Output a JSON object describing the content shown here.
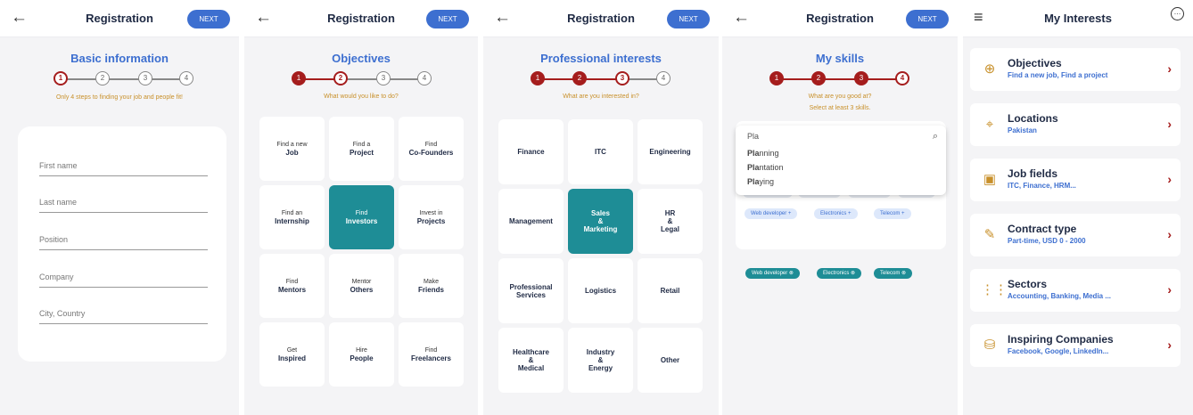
{
  "screen1": {
    "title": "Registration",
    "next": "NEXT",
    "heading": "Basic information",
    "steps": [
      "1",
      "2",
      "3",
      "4"
    ],
    "hint": "Only 4 steps to finding your job and people fit!",
    "fields": [
      "First name",
      "Last name",
      "Position",
      "Company",
      "City, Country"
    ]
  },
  "screen2": {
    "title": "Registration",
    "next": "NEXT",
    "heading": "Objectives",
    "steps": [
      "1",
      "2",
      "3",
      "4"
    ],
    "hint": "What would you like to do?",
    "tiles": [
      [
        "Find a new",
        "Job"
      ],
      [
        "Find a",
        "Project"
      ],
      [
        "Find",
        "Co-Founders"
      ],
      [
        "Find an",
        "Internship"
      ],
      [
        "Find",
        "Investors"
      ],
      [
        "Invest in",
        "Projects"
      ],
      [
        "Find",
        "Mentors"
      ],
      [
        "Mentor",
        "Others"
      ],
      [
        "Make",
        "Friends"
      ],
      [
        "Get",
        "Inspired"
      ],
      [
        "Hire",
        "People"
      ],
      [
        "Find",
        "Freelancers"
      ]
    ]
  },
  "screen3": {
    "title": "Registration",
    "next": "NEXT",
    "heading": "Professional interests",
    "steps": [
      "1",
      "2",
      "3",
      "4"
    ],
    "hint": "What are you interested in?",
    "tiles": [
      [
        "Finance"
      ],
      [
        "ITC"
      ],
      [
        "Engineering"
      ],
      [
        "Management"
      ],
      [
        "Sales",
        "&",
        "Marketing"
      ],
      [
        "HR",
        "&",
        "Legal"
      ],
      [
        "Professional",
        "Services"
      ],
      [
        "Logistics"
      ],
      [
        "Retail"
      ],
      [
        "Healthcare",
        "&",
        "Medical"
      ],
      [
        "Industry",
        "&",
        "Energy"
      ],
      [
        "Other"
      ]
    ]
  },
  "screen4": {
    "title": "Registration",
    "next": "NEXT",
    "heading": "My skills",
    "steps": [
      "1",
      "2",
      "3",
      "4"
    ],
    "hint1": "What are you good at?",
    "hint2": "Select at least 3 skills.",
    "search": "Pla",
    "suggestions": [
      [
        "Pla",
        "nning"
      ],
      [
        "Pla",
        "ntation"
      ],
      [
        "Pla",
        "ying"
      ]
    ],
    "chips": [
      "Web developer +",
      "Electronics +",
      "Telecom +"
    ],
    "selected": [
      "Web developer ⊗",
      "Electronics ⊗",
      "Telecom ⊗"
    ]
  },
  "screen5": {
    "title": "My Interests",
    "chat_icon": "…",
    "cards": [
      {
        "title": "Objectives",
        "sub": "Find a new job,  Find a project",
        "icon": "crosshair-icon"
      },
      {
        "title": "Locations",
        "sub": "Pakistan",
        "icon": "map-pin-icon"
      },
      {
        "title": "Job fields",
        "sub": "ITC, Finance, HRM...",
        "icon": "briefcase-icon"
      },
      {
        "title": "Contract type",
        "sub": "Part-time, USD 0 - 2000",
        "icon": "edit-icon"
      },
      {
        "title": "Sectors",
        "sub": "Accounting, Banking, Media ...",
        "icon": "grid-dots-icon"
      },
      {
        "title": "Inspiring Companies",
        "sub": "Facebook, Google, LinkedIn...",
        "icon": "database-icon"
      }
    ]
  },
  "colors": {
    "accent": "#3d6fd0",
    "step_red": "#a51d1d",
    "teal": "#1e8d96",
    "hint": "#c8902a"
  }
}
